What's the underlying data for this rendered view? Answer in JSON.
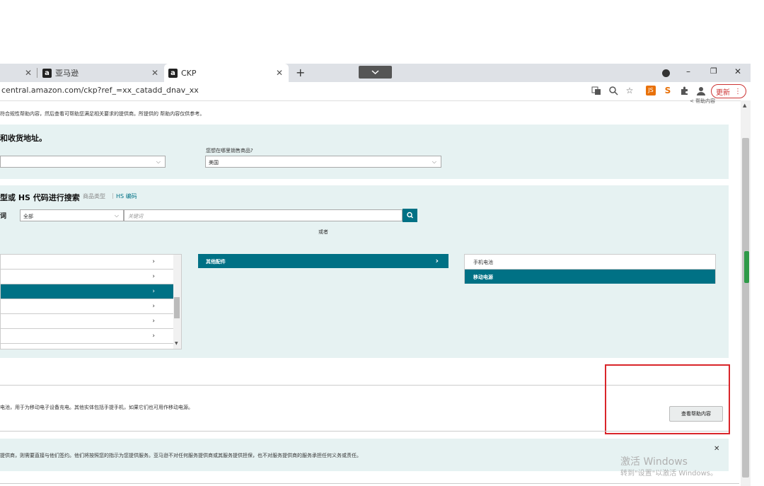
{
  "browser": {
    "tabs": [
      {
        "label": ""
      },
      {
        "label": "亚马逊"
      },
      {
        "label": "CKP"
      }
    ],
    "close_glyph": "✕",
    "new_tab_glyph": "+",
    "url": "central.amazon.com/ckp?ref_=xx_catadd_dnav_xx",
    "update_label": "更新",
    "amz_logo_glyph": "a",
    "window_controls": {
      "minimize": "–",
      "restore": "❐",
      "close": "✕"
    }
  },
  "page": {
    "help_link": "< 帮助内容",
    "notice": "符合规性帮助内容，然后查看可帮助您满足相关要求的提供商。所提供的 帮助内容仅供参考。",
    "address_section": {
      "title": "和收货地址。",
      "sell_label": "您想在哪里销售商品?",
      "country_value": "美国"
    },
    "search_section": {
      "title": "型或 HS 代码进行搜索",
      "link_type": "商品类型",
      "separator": "|",
      "link_hs": "HS 编码",
      "keyword_label": "词",
      "category_value": "全部",
      "search_placeholder": "关键词",
      "or_text": "或者"
    },
    "category_col2": {
      "label": "其他配件"
    },
    "category_col3": {
      "items": [
        {
          "label": "手机电池",
          "selected": false
        },
        {
          "label": "移动电源",
          "selected": true
        }
      ]
    },
    "result": {
      "description": "电池，用于为移动电子设备充电。其他实体包括手提手机，如果它们也可用作移动电源。",
      "help_button": "查看帮助内容"
    },
    "disclaimer": "提供商，则需要直接与他们签约。他们将按照您的指示为您提供服务。亚马逊不对任何服务提供商或其服务提供担保，也不对服务提供商的服务承担任何义务或责任。",
    "watermark_line1": "激活 Windows",
    "watermark_line2": "转到\"设置\"以激活 Windows。"
  },
  "colors": {
    "teal": "#007185",
    "panel": "#e6f2f2",
    "highlight_box": "#d9252a"
  }
}
